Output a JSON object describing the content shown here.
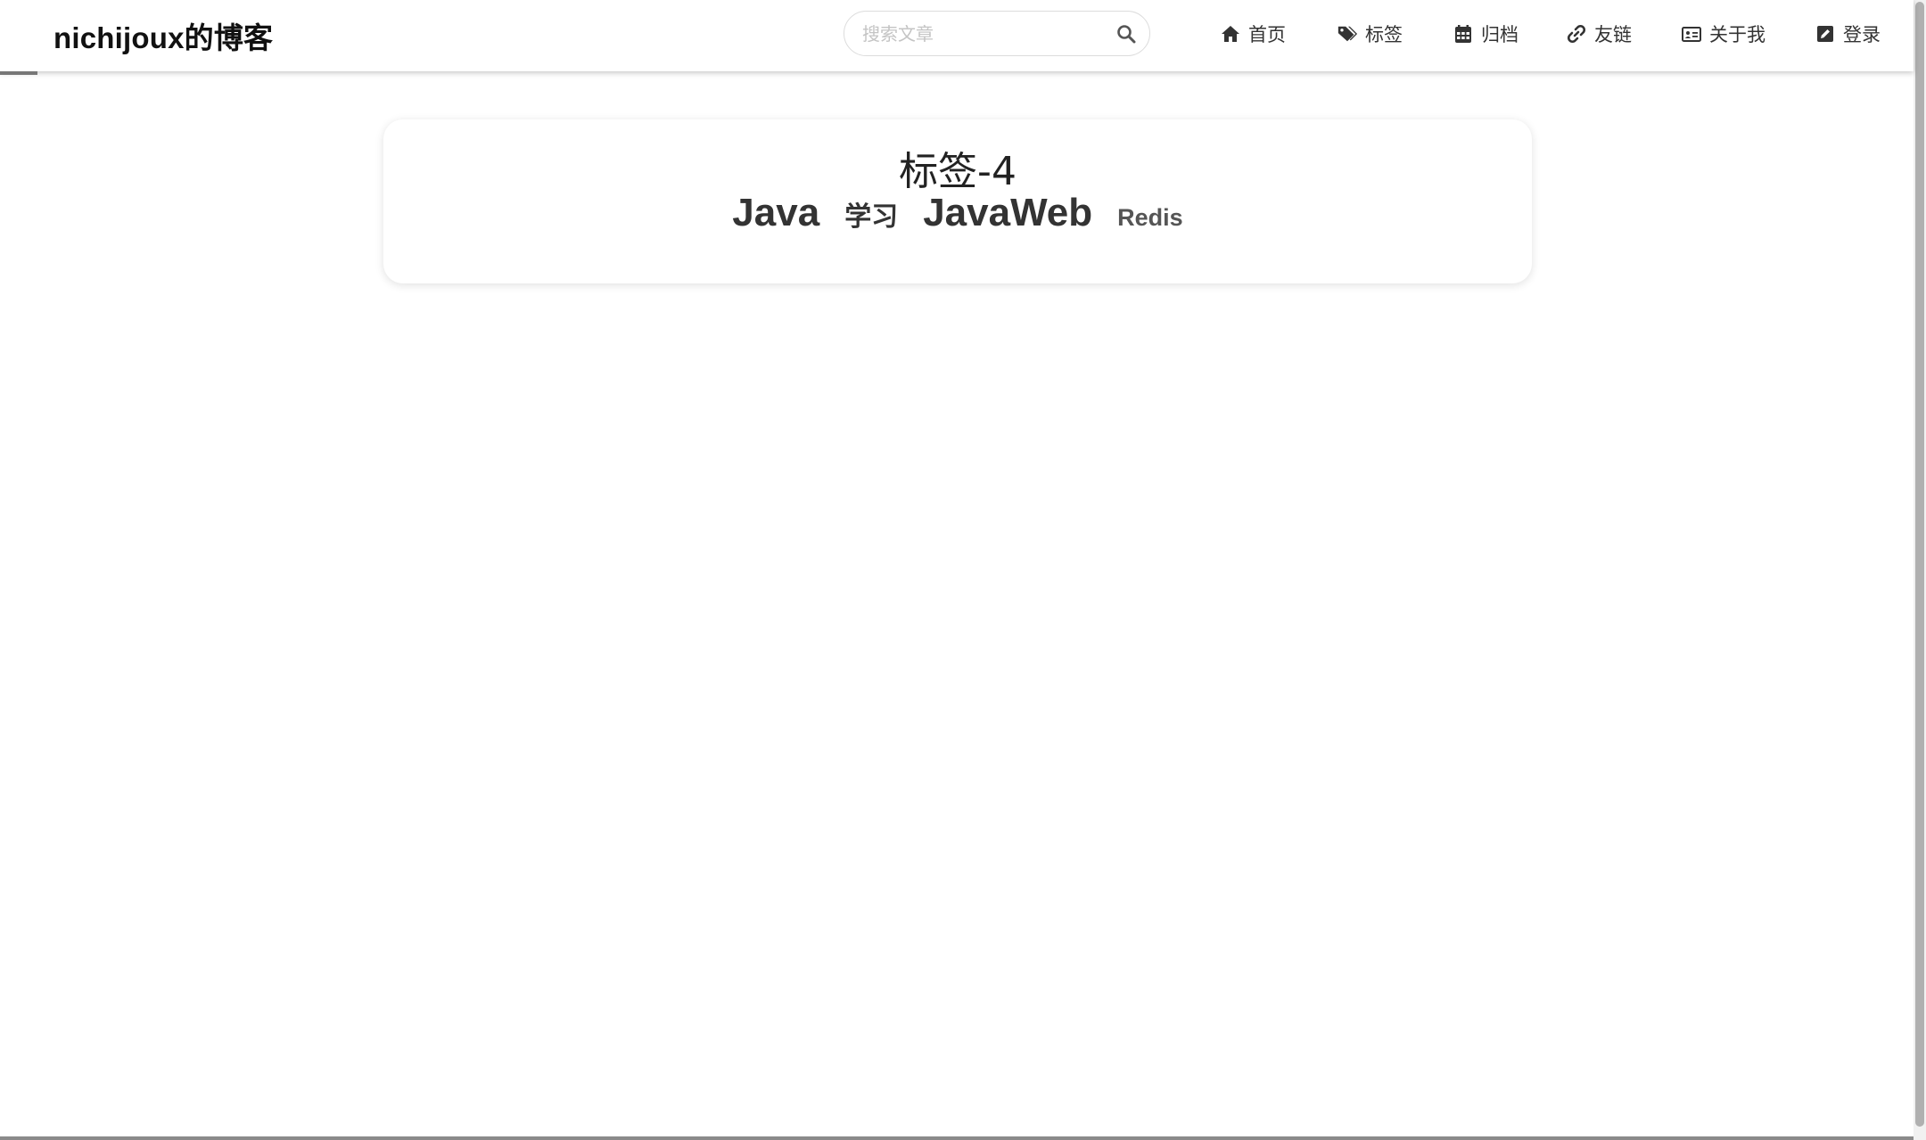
{
  "header": {
    "brand": "nichijoux的博客",
    "search": {
      "placeholder": "搜索文章",
      "icon": "search-icon"
    },
    "nav": [
      {
        "label": "首页",
        "icon": "home-icon"
      },
      {
        "label": "标签",
        "icon": "tags-icon"
      },
      {
        "label": "归档",
        "icon": "calendar-icon"
      },
      {
        "label": "友链",
        "icon": "link-icon"
      },
      {
        "label": "关于我",
        "icon": "id-card-icon"
      },
      {
        "label": "登录",
        "icon": "edit-icon"
      }
    ]
  },
  "main": {
    "title": "标签-4",
    "tags": [
      {
        "label": "Java"
      },
      {
        "label": "学习"
      },
      {
        "label": "JavaWeb"
      },
      {
        "label": "Redis"
      }
    ]
  },
  "colors": {
    "background": "#ffffff",
    "text": "#333333",
    "header_shadow": "#999999"
  }
}
